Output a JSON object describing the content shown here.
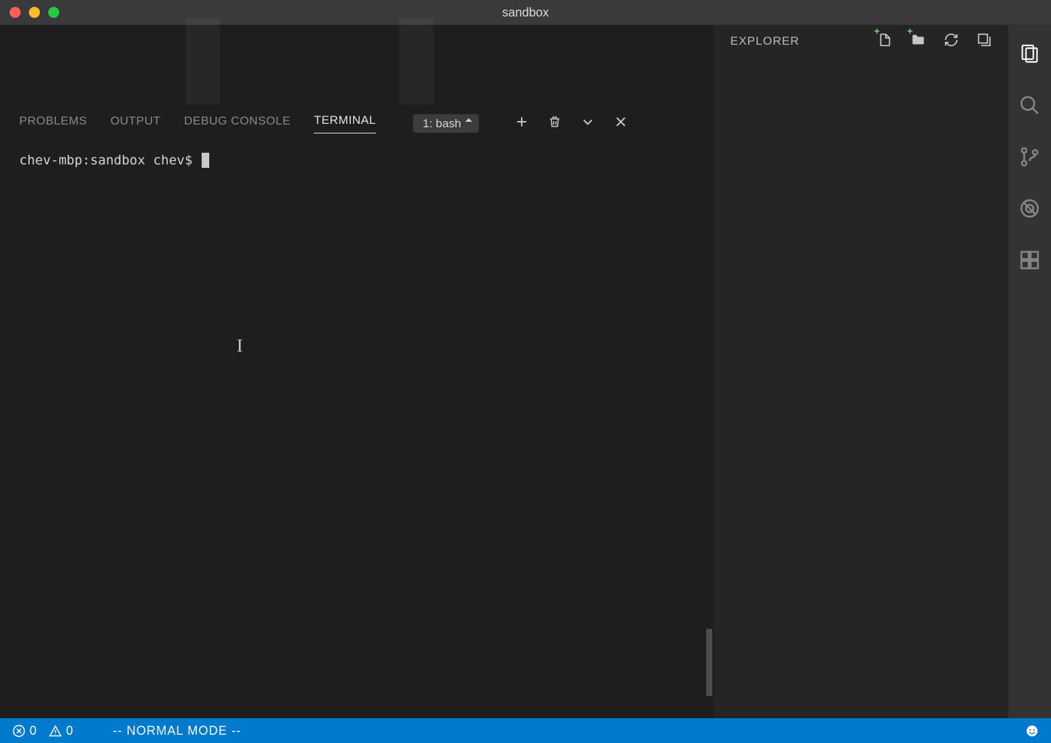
{
  "window": {
    "title": "sandbox"
  },
  "explorer": {
    "title": "EXPLORER"
  },
  "panel": {
    "tabs": {
      "problems": "PROBLEMS",
      "output": "OUTPUT",
      "debug": "DEBUG CONSOLE",
      "terminal": "TERMINAL"
    },
    "terminal_selector": "1: bash"
  },
  "terminal": {
    "prompt": "chev-mbp:sandbox chev$ "
  },
  "status": {
    "errors": "0",
    "warnings": "0",
    "mode": "-- NORMAL MODE --"
  }
}
